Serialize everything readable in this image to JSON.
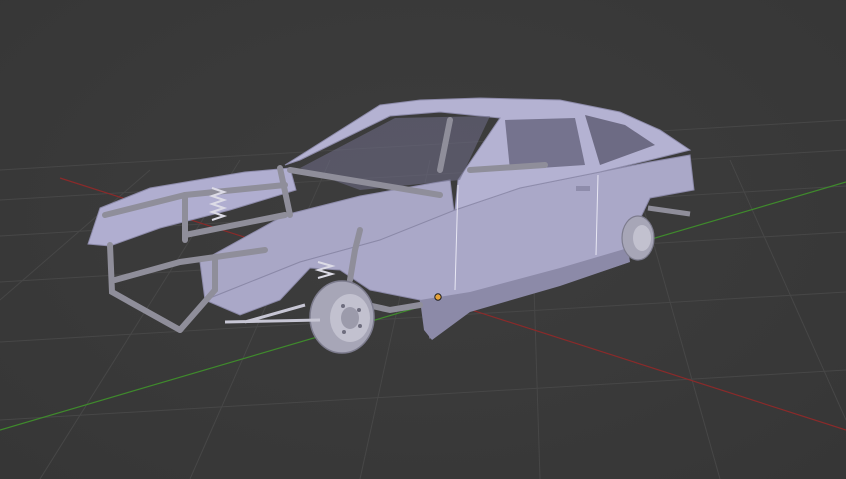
{
  "viewport": {
    "background": "#3a3a3a",
    "grid_color": "#474747",
    "x_axis_color": "#8a2a2a",
    "y_axis_color": "#3f8a2c"
  },
  "scene": {
    "object": "car-body-with-roll-cage",
    "body_color": "#a9a7c6",
    "shadow_color": "#6f6d8c",
    "cage_color": "#8e8d98",
    "origin_marker_color": "#e6a23a"
  }
}
